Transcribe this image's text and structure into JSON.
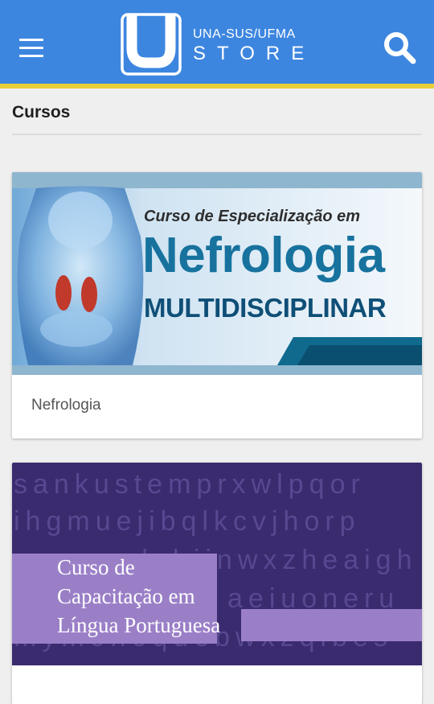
{
  "header": {
    "menu_icon": "hamburger-menu-icon",
    "logo_line1": "UNA-SUS/UFMA",
    "logo_line2": "STORE",
    "search_icon": "search-icon",
    "bar_color": "#3d86e0",
    "accent_color": "#e8cf3a"
  },
  "main": {
    "section_title": "Cursos",
    "courses": [
      {
        "label": "Nefrologia",
        "banner_line1": "Curso de Especialização em",
        "banner_line2": "Nefrologia",
        "banner_line3": "MULTIDISCIPLINAR"
      },
      {
        "label": "",
        "banner_line1": "Curso de",
        "banner_line2": "Capacitação em",
        "banner_line3": "Língua Portuguesa",
        "banner_bg_rows": [
          "sankustemprxwlpqor",
          "ihgmuejibqlkcvjhorp",
          "dcbijnwxzheaigh",
          "aeiuoneru",
          "mymoheqdebwxzqibes"
        ]
      }
    ]
  }
}
